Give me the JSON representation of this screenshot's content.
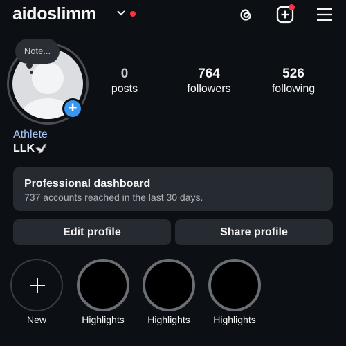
{
  "header": {
    "username": "aidoslimm",
    "icons": [
      "chevron-down-icon",
      "threads-icon",
      "add-post-icon",
      "menu-icon"
    ],
    "notification_color": "#ff3040"
  },
  "profile": {
    "note_label": "Note...",
    "stats": [
      {
        "value": "0",
        "label": "posts"
      },
      {
        "value": "764",
        "label": "followers"
      },
      {
        "value": "526",
        "label": "following"
      }
    ],
    "category": "Athlete",
    "bio": "LLK",
    "bio_emoji": "dove-icon",
    "accent_color": "#3897f0"
  },
  "dashboard": {
    "title": "Professional dashboard",
    "subtitle": "737 accounts reached in the last 30 days."
  },
  "actions": {
    "edit_label": "Edit profile",
    "share_label": "Share profile"
  },
  "highlights": [
    {
      "label": "New"
    },
    {
      "label": "Highlights"
    },
    {
      "label": "Highlights"
    },
    {
      "label": "Highlights"
    }
  ]
}
